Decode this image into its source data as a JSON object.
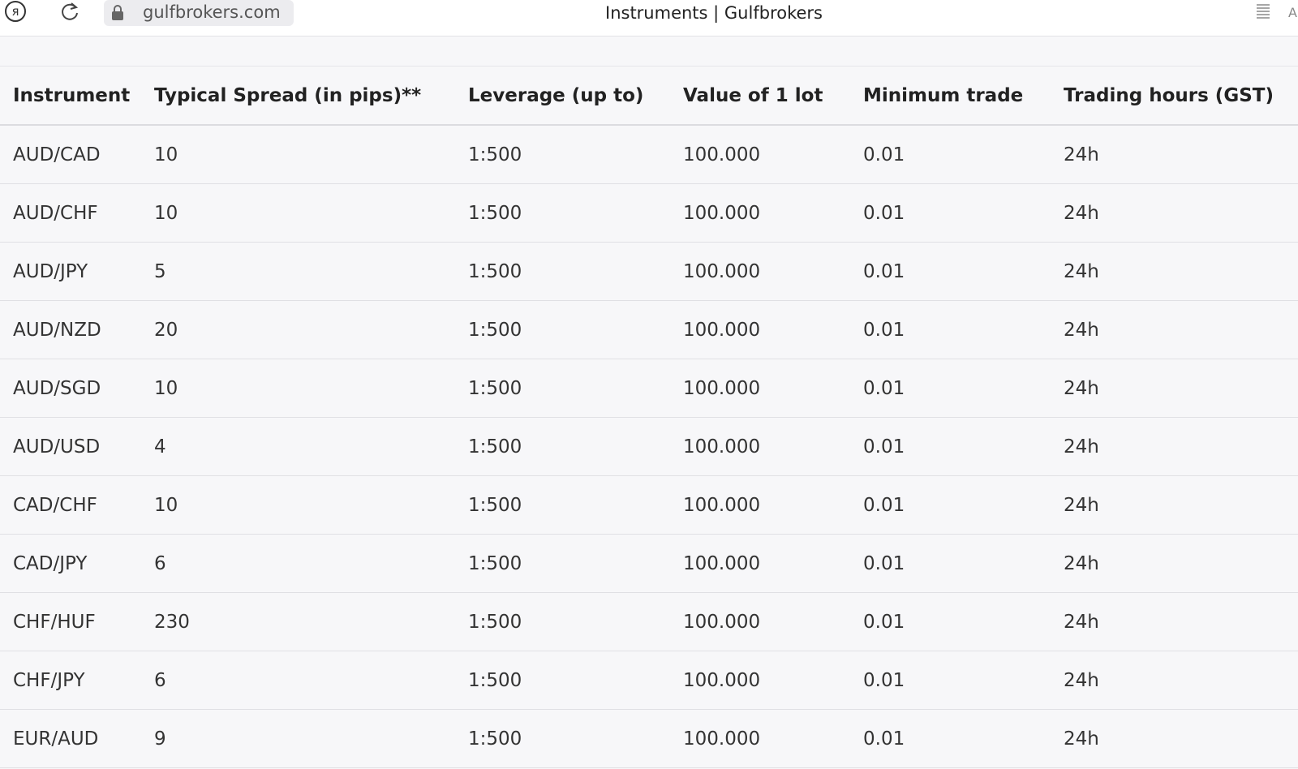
{
  "browser": {
    "address": "gulfbrokers.com",
    "title": "Instruments | Gulfbrokers",
    "yandex_glyph": "я",
    "icons": [
      "yandex-logo-icon",
      "reload-icon",
      "lock-icon",
      "reader-mode-icon"
    ]
  },
  "table": {
    "headers": [
      "Instrument",
      "Typical Spread (in pips)**",
      "Leverage (up to)",
      "Value of 1 lot",
      "Minimum trade",
      "Trading hours (GST)"
    ],
    "rows": [
      [
        "AUD/CAD",
        "10",
        "1:500",
        "100.000",
        "0.01",
        "24h"
      ],
      [
        "AUD/CHF",
        "10",
        "1:500",
        "100.000",
        "0.01",
        "24h"
      ],
      [
        "AUD/JPY",
        "5",
        "1:500",
        "100.000",
        "0.01",
        "24h"
      ],
      [
        "AUD/NZD",
        "20",
        "1:500",
        "100.000",
        "0.01",
        "24h"
      ],
      [
        "AUD/SGD",
        "10",
        "1:500",
        "100.000",
        "0.01",
        "24h"
      ],
      [
        "AUD/USD",
        "4",
        "1:500",
        "100.000",
        "0.01",
        "24h"
      ],
      [
        "CAD/CHF",
        "10",
        "1:500",
        "100.000",
        "0.01",
        "24h"
      ],
      [
        "CAD/JPY",
        "6",
        "1:500",
        "100.000",
        "0.01",
        "24h"
      ],
      [
        "CHF/HUF",
        "230",
        "1:500",
        "100.000",
        "0.01",
        "24h"
      ],
      [
        "CHF/JPY",
        "6",
        "1:500",
        "100.000",
        "0.01",
        "24h"
      ],
      [
        "EUR/AUD",
        "9",
        "1:500",
        "100.000",
        "0.01",
        "24h"
      ]
    ]
  }
}
